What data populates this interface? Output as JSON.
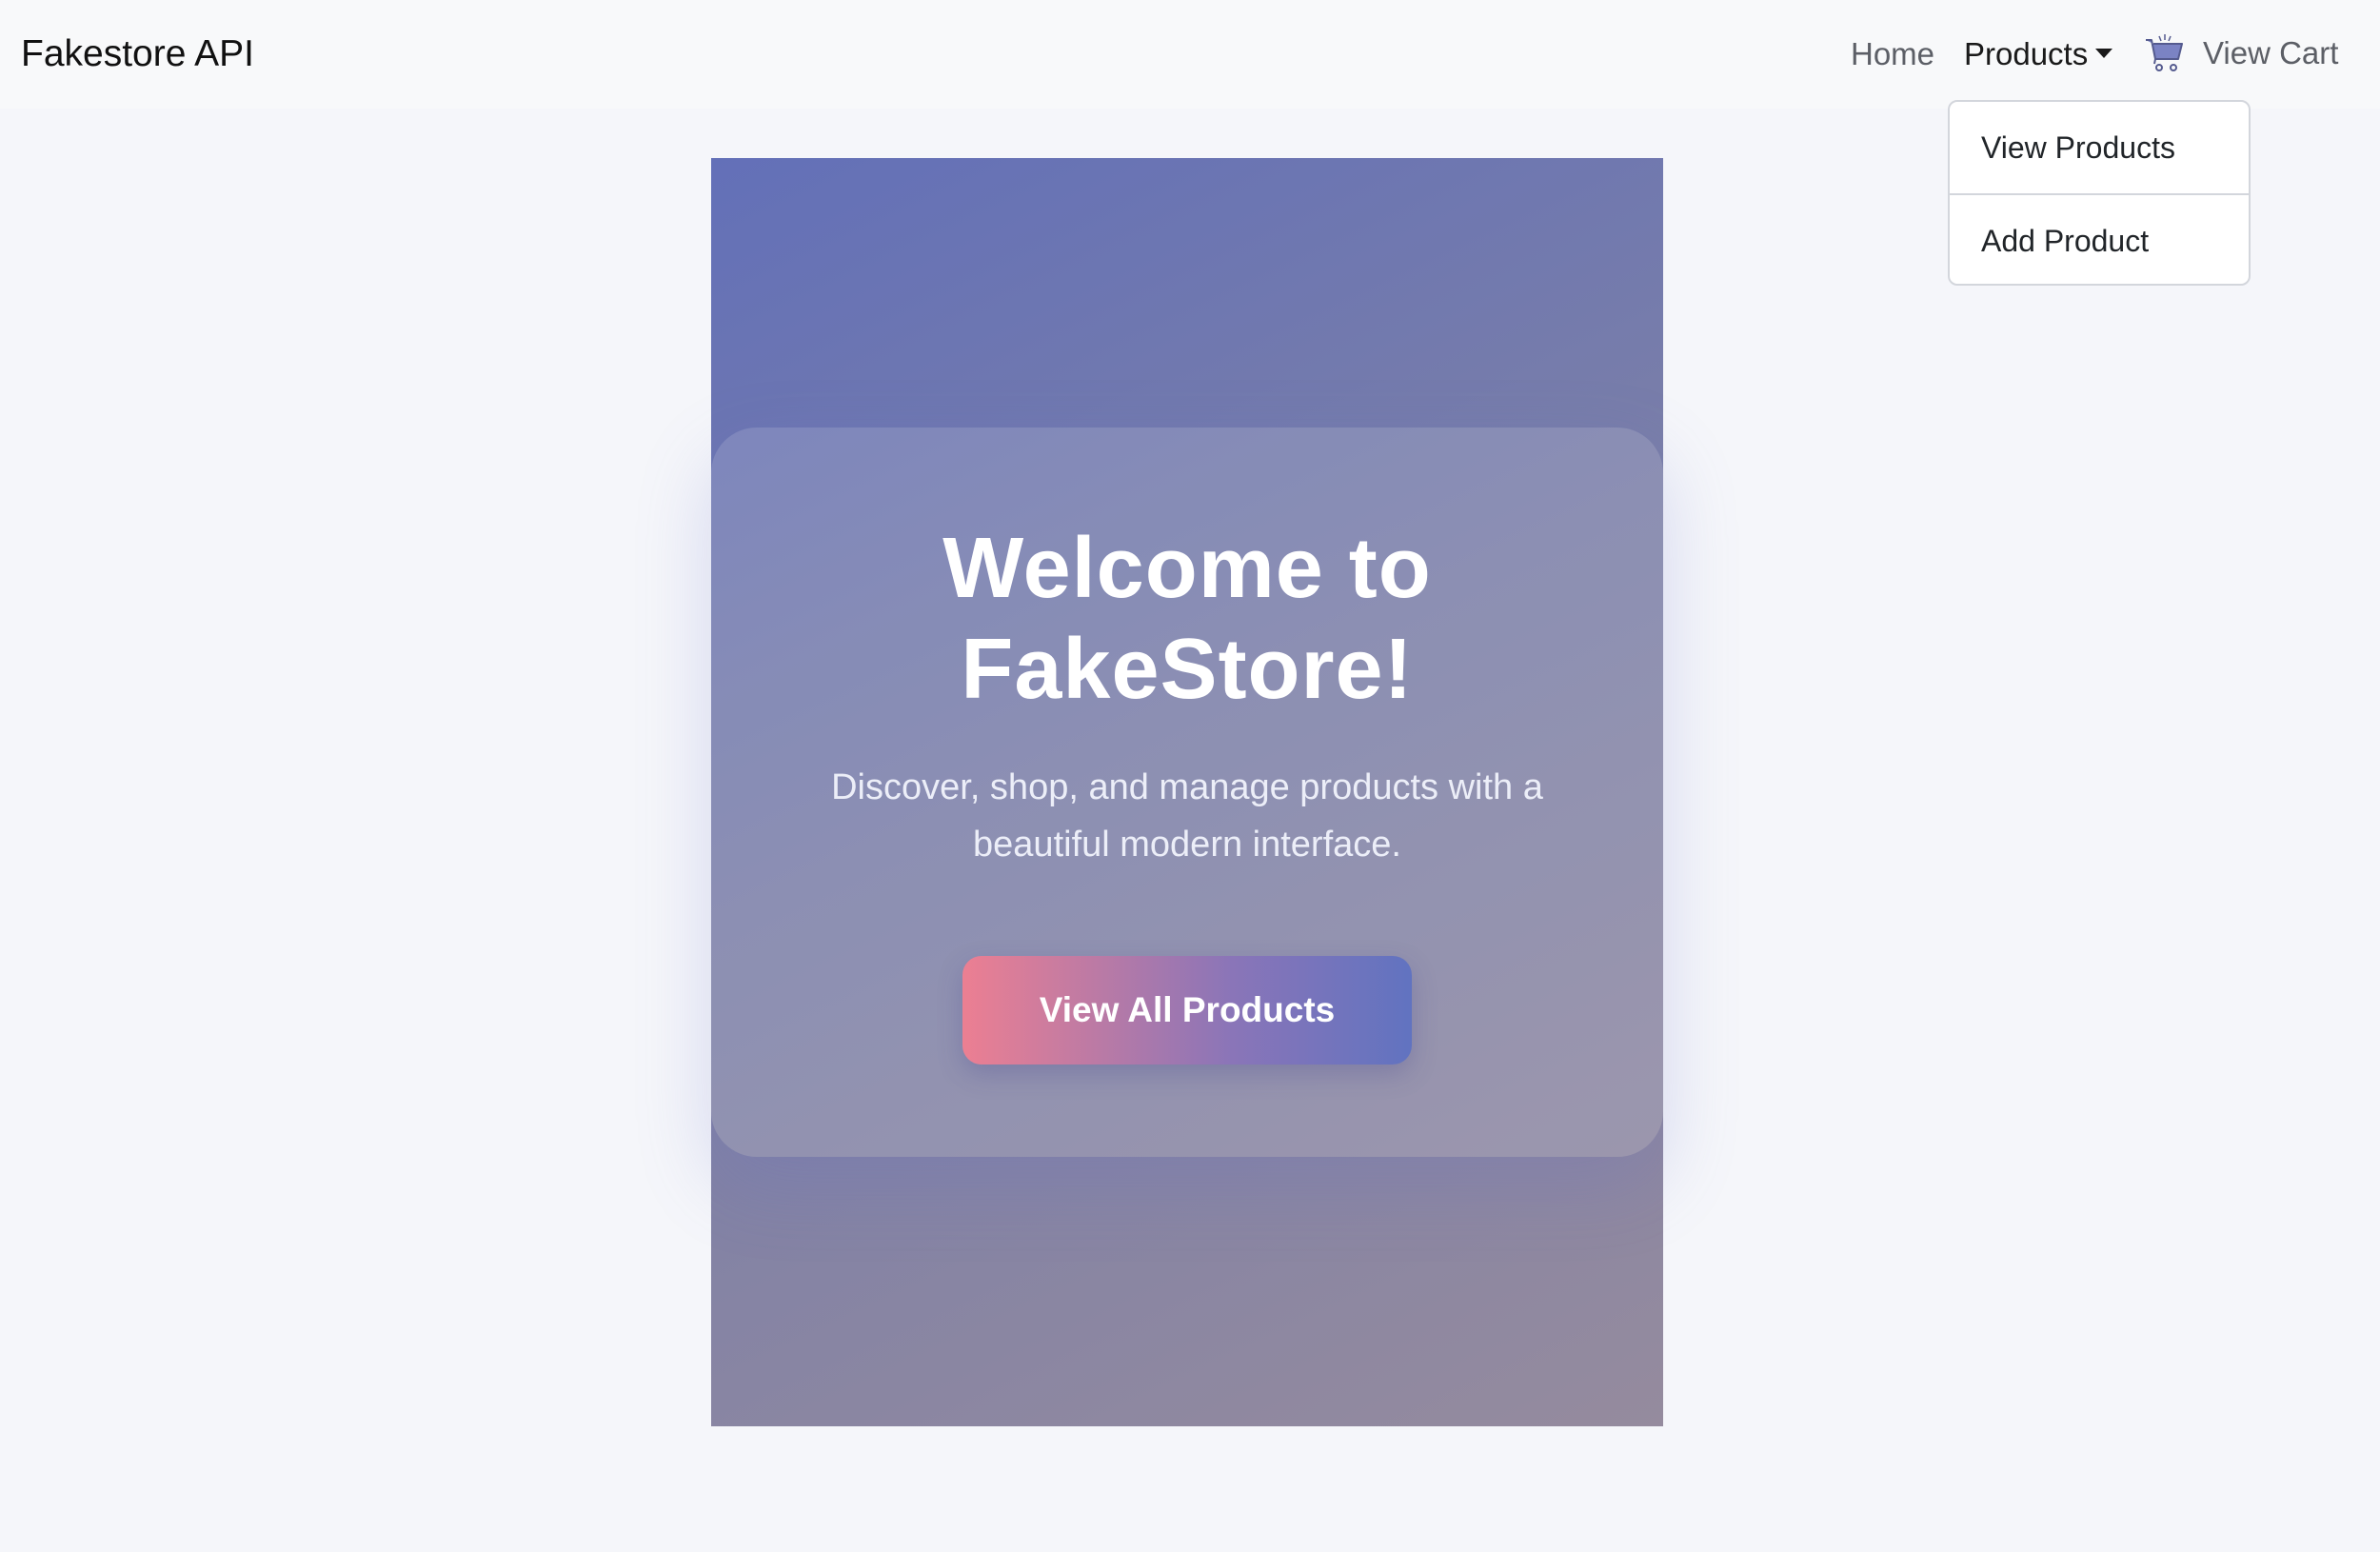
{
  "navbar": {
    "brand": "Fakestore API",
    "home_label": "Home",
    "products_label": "Products",
    "cart_label": "View Cart"
  },
  "products_dropdown": {
    "items": [
      {
        "label": "View Products"
      },
      {
        "label": "Add Product"
      }
    ]
  },
  "hero": {
    "title": "Welcome to FakeStore!",
    "subtitle": "Discover, shop, and manage products with a beautiful modern interface.",
    "button_label": "View All Products"
  },
  "colors": {
    "hero_gradient_start": "#6370b8",
    "hero_gradient_end": "#958b9e",
    "button_gradient_start": "#ec7f92",
    "button_gradient_end": "#6173c0",
    "navbar_bg": "#f8f9fa"
  },
  "icons": {
    "cart": "shopping-cart-icon",
    "dropdown": "caret-down-icon"
  }
}
